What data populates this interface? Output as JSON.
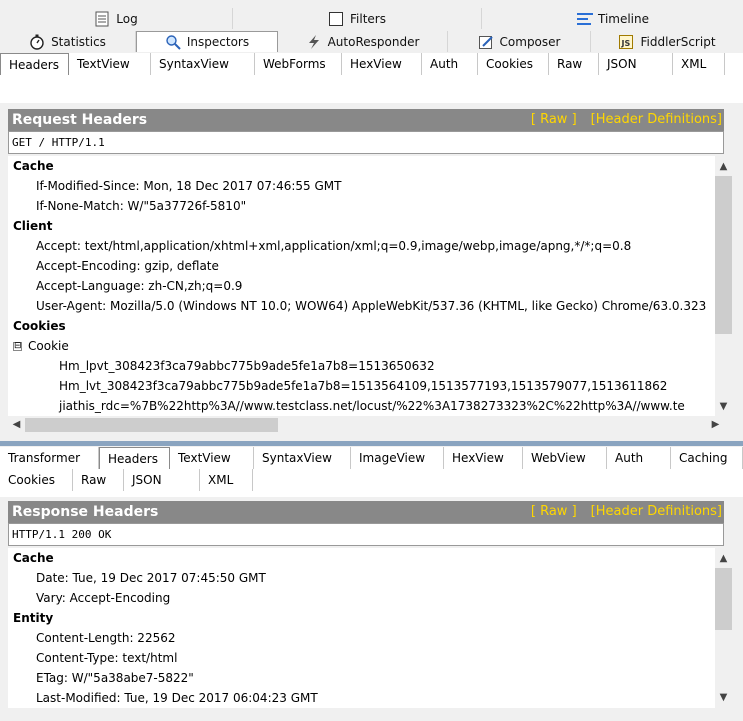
{
  "top_tabs": {
    "row1": [
      {
        "label": "Log",
        "icon": "log-icon"
      },
      {
        "label": "Filters",
        "icon": "checkbox-icon"
      },
      {
        "label": "Timeline",
        "icon": "timeline-icon"
      }
    ],
    "row2": [
      {
        "label": "Statistics",
        "icon": "stopwatch-icon"
      },
      {
        "label": "Inspectors",
        "icon": "inspector-icon",
        "active": true
      },
      {
        "label": "AutoResponder",
        "icon": "lightning-icon"
      },
      {
        "label": "Composer",
        "icon": "composer-icon"
      },
      {
        "label": "FiddlerScript",
        "icon": "js-icon"
      }
    ]
  },
  "request": {
    "tabs": [
      "Headers",
      "TextView",
      "SyntaxView",
      "WebForms",
      "HexView",
      "Auth",
      "Cookies",
      "Raw",
      "JSON",
      "XML"
    ],
    "active_tab": "Headers",
    "title": "Request Headers",
    "raw_link": "[ Raw ]",
    "defs_link": "[Header Definitions]",
    "request_line": "GET / HTTP/1.1",
    "lines": [
      {
        "kind": "grp",
        "text": "Cache"
      },
      {
        "kind": "item",
        "text": "If-Modified-Since: Mon, 18 Dec 2017 07:46:55 GMT"
      },
      {
        "kind": "item",
        "text": "If-None-Match: W/\"5a37726f-5810\""
      },
      {
        "kind": "grp",
        "text": "Client"
      },
      {
        "kind": "item",
        "text": "Accept: text/html,application/xhtml+xml,application/xml;q=0.9,image/webp,image/apng,*/*;q=0.8"
      },
      {
        "kind": "item",
        "text": "Accept-Encoding: gzip, deflate"
      },
      {
        "kind": "item",
        "text": "Accept-Language: zh-CN,zh;q=0.9"
      },
      {
        "kind": "item",
        "text": "User-Agent: Mozilla/5.0 (Windows NT 10.0; WOW64) AppleWebKit/537.36 (KHTML, like Gecko) Chrome/63.0.323"
      },
      {
        "kind": "grp",
        "text": "Cookies"
      },
      {
        "kind": "exp",
        "text": "Cookie",
        "toggle": "⊟"
      },
      {
        "kind": "sub",
        "text": "Hm_lpvt_308423f3ca79abbc775b9ade5fe1a7b8=1513650632"
      },
      {
        "kind": "sub",
        "text": "Hm_lvt_308423f3ca79abbc775b9ade5fe1a7b8=1513564109,1513577193,1513579077,1513611862"
      },
      {
        "kind": "sub",
        "text": "jiathis_rdc=%7B%22http%3A//www.testclass.net/locust/%22%3A1738273323%2C%22http%3A//www.te"
      }
    ]
  },
  "response": {
    "tabs": [
      "Transformer",
      "Headers",
      "TextView",
      "SyntaxView",
      "ImageView",
      "HexView",
      "WebView",
      "Auth",
      "Caching",
      "Cookies",
      "Raw",
      "JSON",
      "XML"
    ],
    "active_tab": "Headers",
    "title": "Response Headers",
    "raw_link": "[ Raw ]",
    "defs_link": "[Header Definitions]",
    "status_line": "HTTP/1.1 200 OK",
    "lines": [
      {
        "kind": "grp",
        "text": "Cache"
      },
      {
        "kind": "item",
        "text": "Date: Tue, 19 Dec 2017 07:45:50 GMT"
      },
      {
        "kind": "item",
        "text": "Vary: Accept-Encoding"
      },
      {
        "kind": "grp",
        "text": "Entity"
      },
      {
        "kind": "item",
        "text": "Content-Length: 22562"
      },
      {
        "kind": "item",
        "text": "Content-Type: text/html"
      },
      {
        "kind": "item",
        "text": "ETag: W/\"5a38abe7-5822\""
      },
      {
        "kind": "item",
        "text": "Last-Modified: Tue, 19 Dec 2017 06:04:23 GMT"
      }
    ]
  }
}
